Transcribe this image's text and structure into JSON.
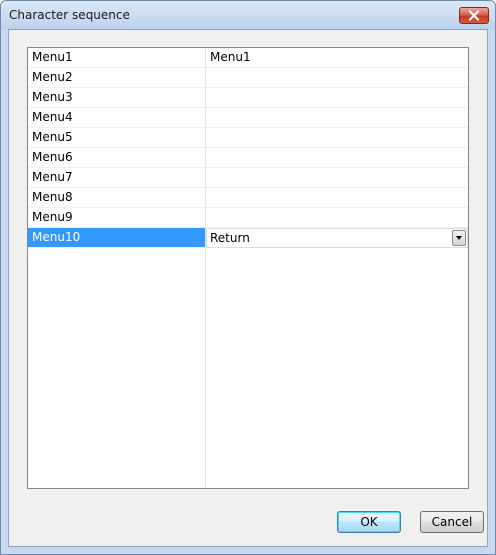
{
  "window": {
    "title": "Character sequence"
  },
  "grid": {
    "rows": [
      {
        "name": "Menu1",
        "value": "Menu1"
      },
      {
        "name": "Menu2",
        "value": ""
      },
      {
        "name": "Menu3",
        "value": ""
      },
      {
        "name": "Menu4",
        "value": ""
      },
      {
        "name": "Menu5",
        "value": ""
      },
      {
        "name": "Menu6",
        "value": ""
      },
      {
        "name": "Menu7",
        "value": ""
      },
      {
        "name": "Menu8",
        "value": ""
      },
      {
        "name": "Menu9",
        "value": ""
      },
      {
        "name": "Menu10",
        "value": "Return"
      }
    ],
    "selected_row_name": "Menu10"
  },
  "buttons": {
    "ok_label": "OK",
    "cancel_label": "Cancel"
  },
  "colors": {
    "selection": "#3399ff",
    "title_bar": "#cbdcf0",
    "close_button": "#c33b27",
    "dialog_background": "#f0f0f0"
  },
  "icons": {
    "close": "close-icon",
    "dropdown": "chevron-down-icon"
  }
}
